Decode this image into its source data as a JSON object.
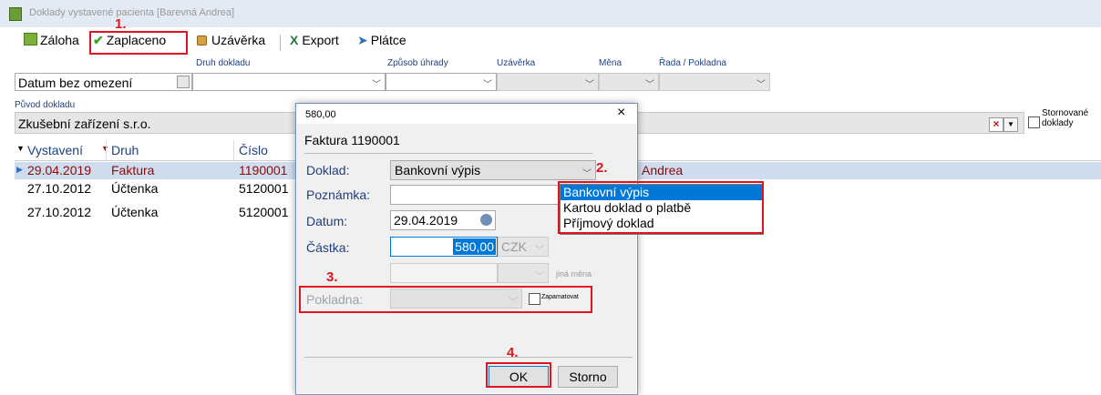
{
  "window": {
    "title": "Doklady vystavené pacienta [Barevná Andrea]"
  },
  "toolbar": {
    "zaloha": "Záloha",
    "zaplaceno": "Zaplaceno",
    "uzaverka": "Uzávěrka",
    "export": "Export",
    "platce": "Plátce"
  },
  "filters": {
    "druh_label": "Druh dokladu",
    "zpusob_label": "Způsob úhrady",
    "uzaverka_label": "Uzávěrka",
    "mena_label": "Měna",
    "rada_label": "Řada / Pokladna",
    "datum_value": "Datum bez omezení",
    "puvod_label": "Původ dokladu",
    "puvod_value": "Zkušební zařízení s.r.o.",
    "stornovane": "Stornované doklady"
  },
  "grid": {
    "columns": [
      "Vystavení",
      "Druh",
      "Číslo"
    ],
    "rows": [
      {
        "date": "29.04.2019",
        "type": "Faktura",
        "number": "1190001"
      },
      {
        "date": "27.10.2012",
        "type": "Účtenka",
        "number": "5120001"
      },
      {
        "date": "27.10.2012",
        "type": "Účtenka",
        "number": "5120001"
      }
    ],
    "patient_fragment": "Andrea"
  },
  "dialog": {
    "title": "580,00",
    "heading": "Faktura 1190001",
    "doklad_label": "Doklad:",
    "doklad_value": "Bankovní výpis",
    "poznamka_label": "Poznámka:",
    "datum_label": "Datum:",
    "datum_value": "29.04.2019",
    "castka_label": "Částka:",
    "castka_value": "580,00",
    "currency": "CZK",
    "jina_mena": "jiná měna",
    "pokladna_label": "Pokladna:",
    "zapamatovat": "Zapamatovat",
    "ok": "OK",
    "storno": "Storno",
    "dropdown_options": [
      "Bankovní výpis",
      "Kartou doklad o platbě",
      "Příjmový doklad"
    ]
  },
  "steps": [
    "1.",
    "2.",
    "3.",
    "4."
  ],
  "colors": {
    "highlight": "#e0141e",
    "selection": "#0078d7",
    "accent_text": "#8b0a0a"
  }
}
